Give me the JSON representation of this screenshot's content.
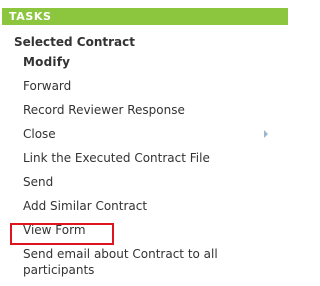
{
  "panel": {
    "header": "TASKS",
    "section_title": "Selected Contract",
    "items": [
      {
        "label": "Modify",
        "bold": true
      },
      {
        "label": "Forward"
      },
      {
        "label": "Record Reviewer Response"
      },
      {
        "label": "Close",
        "has_submenu": true
      },
      {
        "label": "Link the Executed Contract File"
      },
      {
        "label": "Send"
      },
      {
        "label": "Add Similar Contract"
      },
      {
        "label": "View Form",
        "highlighted": true
      },
      {
        "label": "Send email about Contract to all participants"
      }
    ]
  },
  "colors": {
    "header_bg": "#8cc63f",
    "highlight_border": "#e0141e",
    "text": "#333333",
    "arrow": "#9bb8d3"
  },
  "icons": {
    "submenu": "chevron-right-icon"
  }
}
